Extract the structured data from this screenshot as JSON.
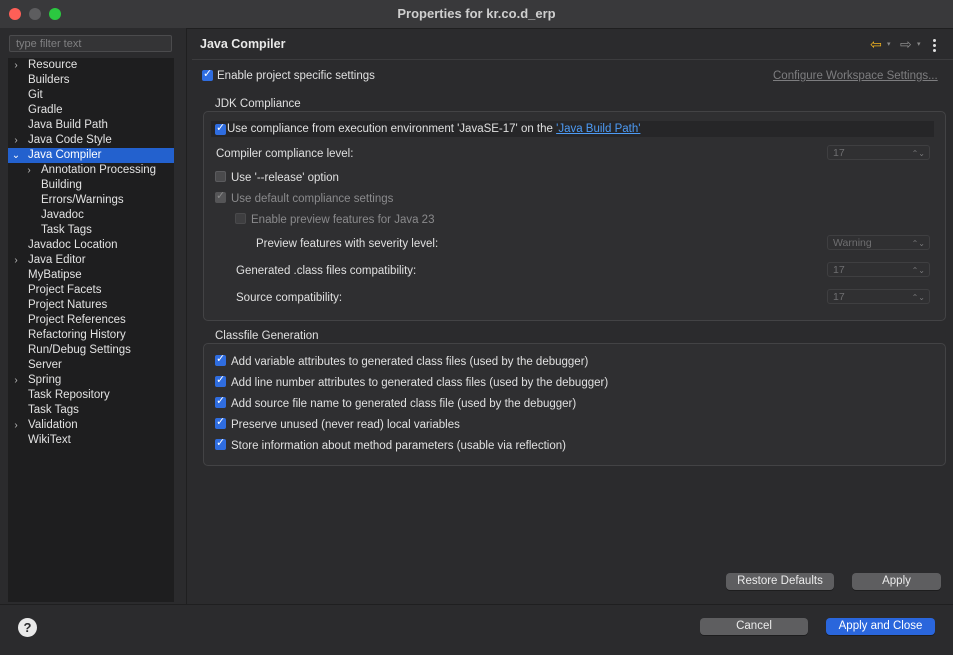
{
  "window": {
    "title": "Properties for kr.co.d_erp"
  },
  "filter": {
    "placeholder": "type filter text"
  },
  "tree": [
    {
      "label": "Resource",
      "expander": "›"
    },
    {
      "label": "Builders",
      "expander": ""
    },
    {
      "label": "Git",
      "expander": ""
    },
    {
      "label": "Gradle",
      "expander": ""
    },
    {
      "label": "Java Build Path",
      "expander": ""
    },
    {
      "label": "Java Code Style",
      "expander": "›"
    },
    {
      "label": "Java Compiler",
      "expander": "⌄"
    },
    {
      "label": "Annotation Processing",
      "expander": "›"
    },
    {
      "label": "Building",
      "expander": ""
    },
    {
      "label": "Errors/Warnings",
      "expander": ""
    },
    {
      "label": "Javadoc",
      "expander": ""
    },
    {
      "label": "Task Tags",
      "expander": ""
    },
    {
      "label": "Javadoc Location",
      "expander": ""
    },
    {
      "label": "Java Editor",
      "expander": "›"
    },
    {
      "label": "MyBatipse",
      "expander": ""
    },
    {
      "label": "Project Facets",
      "expander": ""
    },
    {
      "label": "Project Natures",
      "expander": ""
    },
    {
      "label": "Project References",
      "expander": ""
    },
    {
      "label": "Refactoring History",
      "expander": ""
    },
    {
      "label": "Run/Debug Settings",
      "expander": ""
    },
    {
      "label": "Server",
      "expander": ""
    },
    {
      "label": "Spring",
      "expander": "›"
    },
    {
      "label": "Task Repository",
      "expander": ""
    },
    {
      "label": "Task Tags",
      "expander": ""
    },
    {
      "label": "Validation",
      "expander": "›"
    },
    {
      "label": "WikiText",
      "expander": ""
    }
  ],
  "page": {
    "title": "Java Compiler",
    "nav_back_icon": "⇦",
    "nav_fwd_icon": "⇨",
    "dropdown_glyph": "▾",
    "menu_icon": "⋮",
    "enable_specific": "Enable project specific settings",
    "configure_link": "Configure Workspace Settings..."
  },
  "jdk": {
    "group_title": "JDK Compliance",
    "use_env_prefix": "Use compliance from execution environment 'JavaSE-17' on the ",
    "use_env_link": "'Java Build Path'",
    "compliance_label": "Compiler compliance level:",
    "compliance_value": "17",
    "release_option": "Use '--release' option",
    "default_settings": "Use default compliance settings",
    "preview_features": "Enable preview features for Java 23",
    "preview_severity_label": "Preview features with severity level:",
    "preview_severity_value": "Warning",
    "generated_label": "Generated .class files compatibility:",
    "generated_value": "17",
    "source_label": "Source compatibility:",
    "source_value": "17",
    "select_chevron": "⌃⌄"
  },
  "classfile": {
    "group_title": "Classfile Generation",
    "options": [
      "Add variable attributes to generated class files (used by the debugger)",
      "Add line number attributes to generated class files (used by the debugger)",
      "Add source file name to generated class file (used by the debugger)",
      "Preserve unused (never read) local variables",
      "Store information about method parameters (usable via reflection)"
    ]
  },
  "buttons": {
    "restore_defaults": "Restore Defaults",
    "apply": "Apply",
    "cancel": "Cancel",
    "apply_close": "Apply and Close",
    "help": "?"
  },
  "colors": {
    "accent": "#2f6de0",
    "selection": "#2361ce",
    "link": "#4d9bf5",
    "back_arrow": "#f3b41f"
  }
}
